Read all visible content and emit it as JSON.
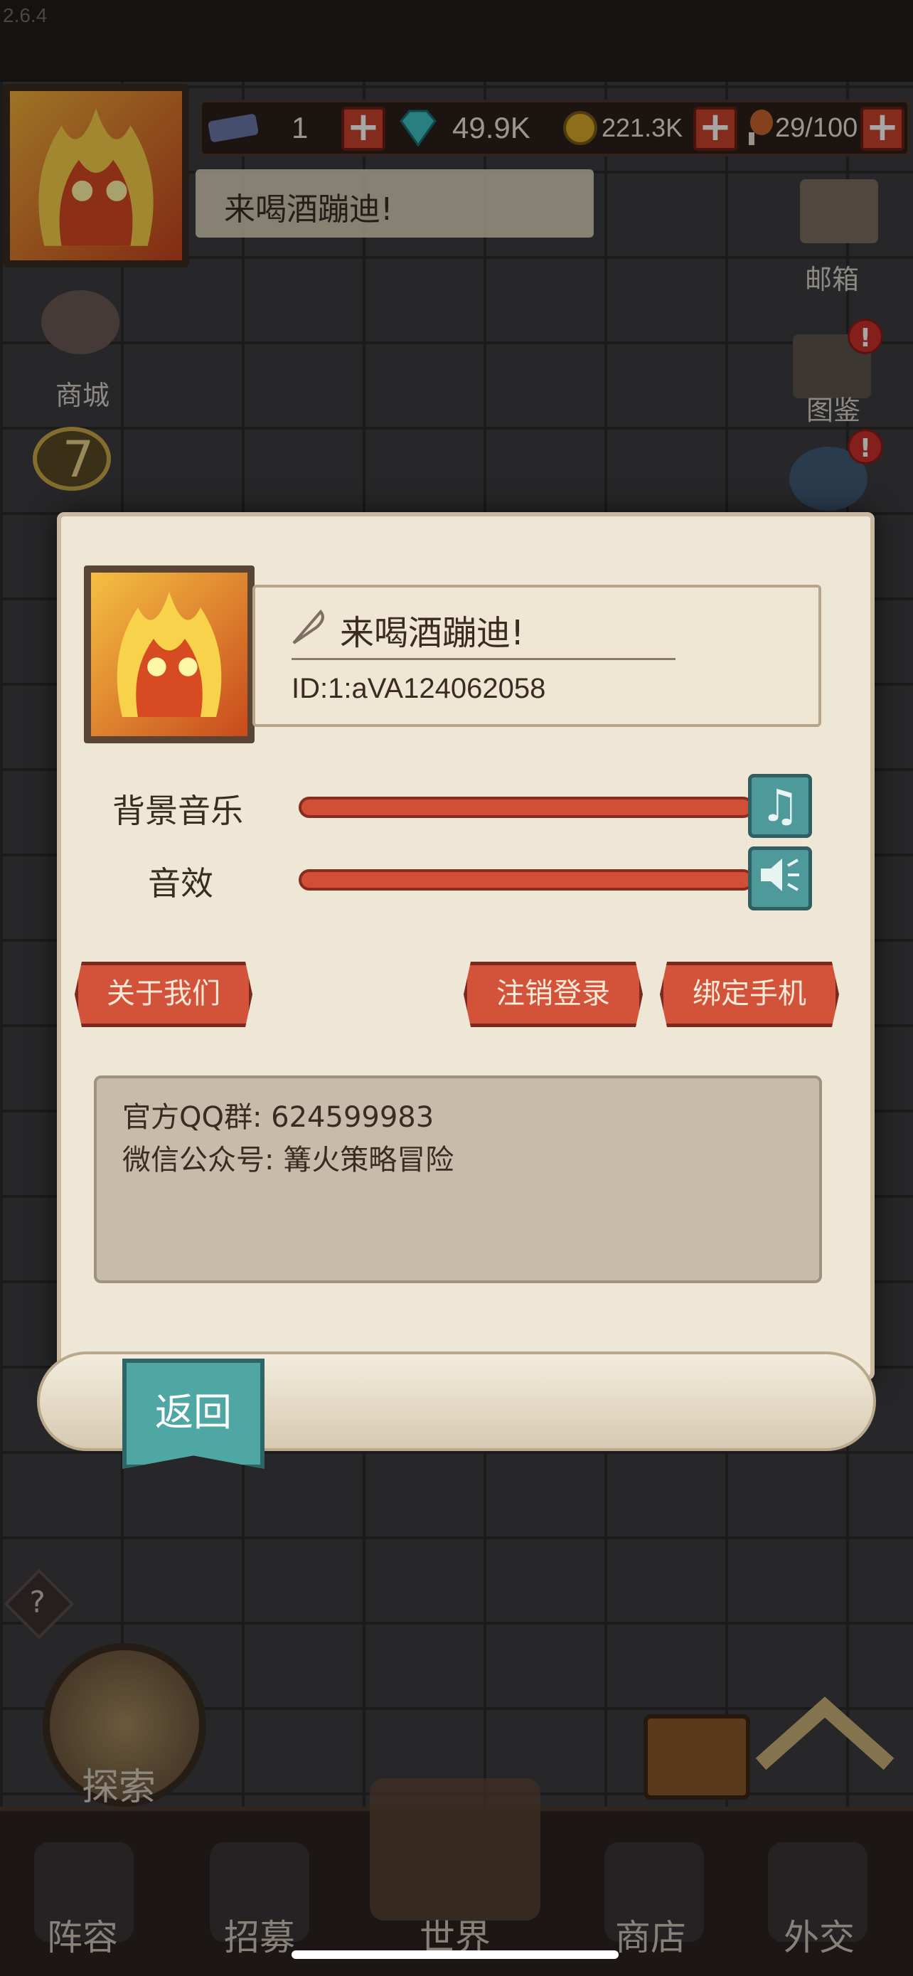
{
  "app": {
    "version": "2.6.4"
  },
  "resources": {
    "item_count": "1",
    "gems": "49.9K",
    "gold": "221.3K",
    "stamina": "29/100",
    "colors": {
      "plus": "#c9422c"
    }
  },
  "header": {
    "player_name": "来喝酒蹦迪!"
  },
  "side_menu": {
    "shop": "商城",
    "mail": "邮箱",
    "codex": "图鉴",
    "level": "7",
    "alert": "!"
  },
  "settings_dialog": {
    "player_name": "来喝酒蹦迪!",
    "player_id": "ID:1:aVA124062058",
    "music_label": "背景音乐",
    "sfx_label": "音效",
    "music_level": 1.0,
    "sfx_level": 1.0,
    "about_button": "关于我们",
    "logout_button": "注销登录",
    "bind_phone_button": "绑定手机",
    "info": {
      "qq_group": "官方QQ群: 624599983",
      "wechat": "微信公众号: 篝火策略冒险"
    },
    "back_button": "返回"
  },
  "bottom": {
    "help": "?",
    "explore": "探索",
    "tabs": [
      "阵容",
      "招募",
      "世界",
      "商店",
      "外交"
    ]
  },
  "icons": {
    "music": "music-note-icon",
    "sfx": "speaker-icon",
    "pen": "quill-icon"
  }
}
